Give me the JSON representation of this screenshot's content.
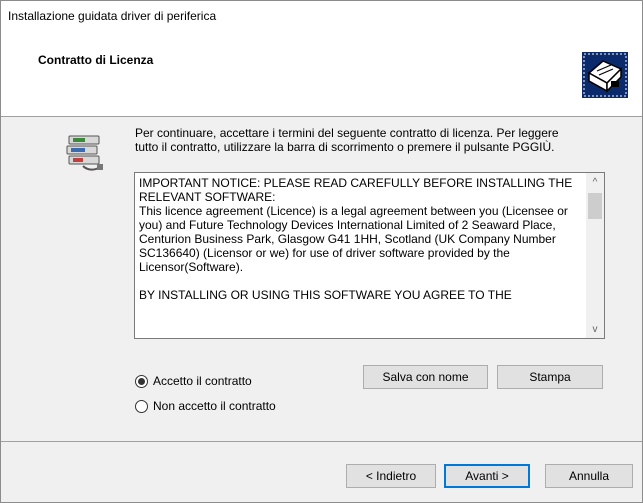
{
  "window": {
    "title": "Installazione guidata driver di periferica"
  },
  "header": {
    "heading": "Contratto di Licenza"
  },
  "content": {
    "intro": "Per continuare, accettare i termini del seguente contratto di licenza. Per leggere tutto il contratto, utilizzare la barra di scorrimento o premere il pulsante PGGIÙ.",
    "license_text": "IMPORTANT NOTICE: PLEASE READ CAREFULLY BEFORE INSTALLING THE RELEVANT SOFTWARE:\nThis licence agreement (Licence) is a legal agreement between you (Licensee or you) and Future Technology Devices International Limited of 2 Seaward Place, Centurion Business Park, Glasgow G41 1HH, Scotland (UK Company Number SC136640) (Licensor or we) for use of driver software provided by the Licensor(Software).\n\nBY INSTALLING OR USING THIS SOFTWARE YOU AGREE TO THE",
    "scroll_up": "^",
    "scroll_down": "v",
    "radio_accept": "Accetto il contratto",
    "radio_reject": "Non accetto il contratto",
    "accept_checked": true,
    "save_label": "Salva con nome",
    "print_label": "Stampa"
  },
  "footer": {
    "back_label": "< Indietro",
    "next_label": "Avanti >",
    "cancel_label": "Annulla"
  },
  "colors": {
    "accent": "#0078d7",
    "panel": "#f0f0f0"
  }
}
